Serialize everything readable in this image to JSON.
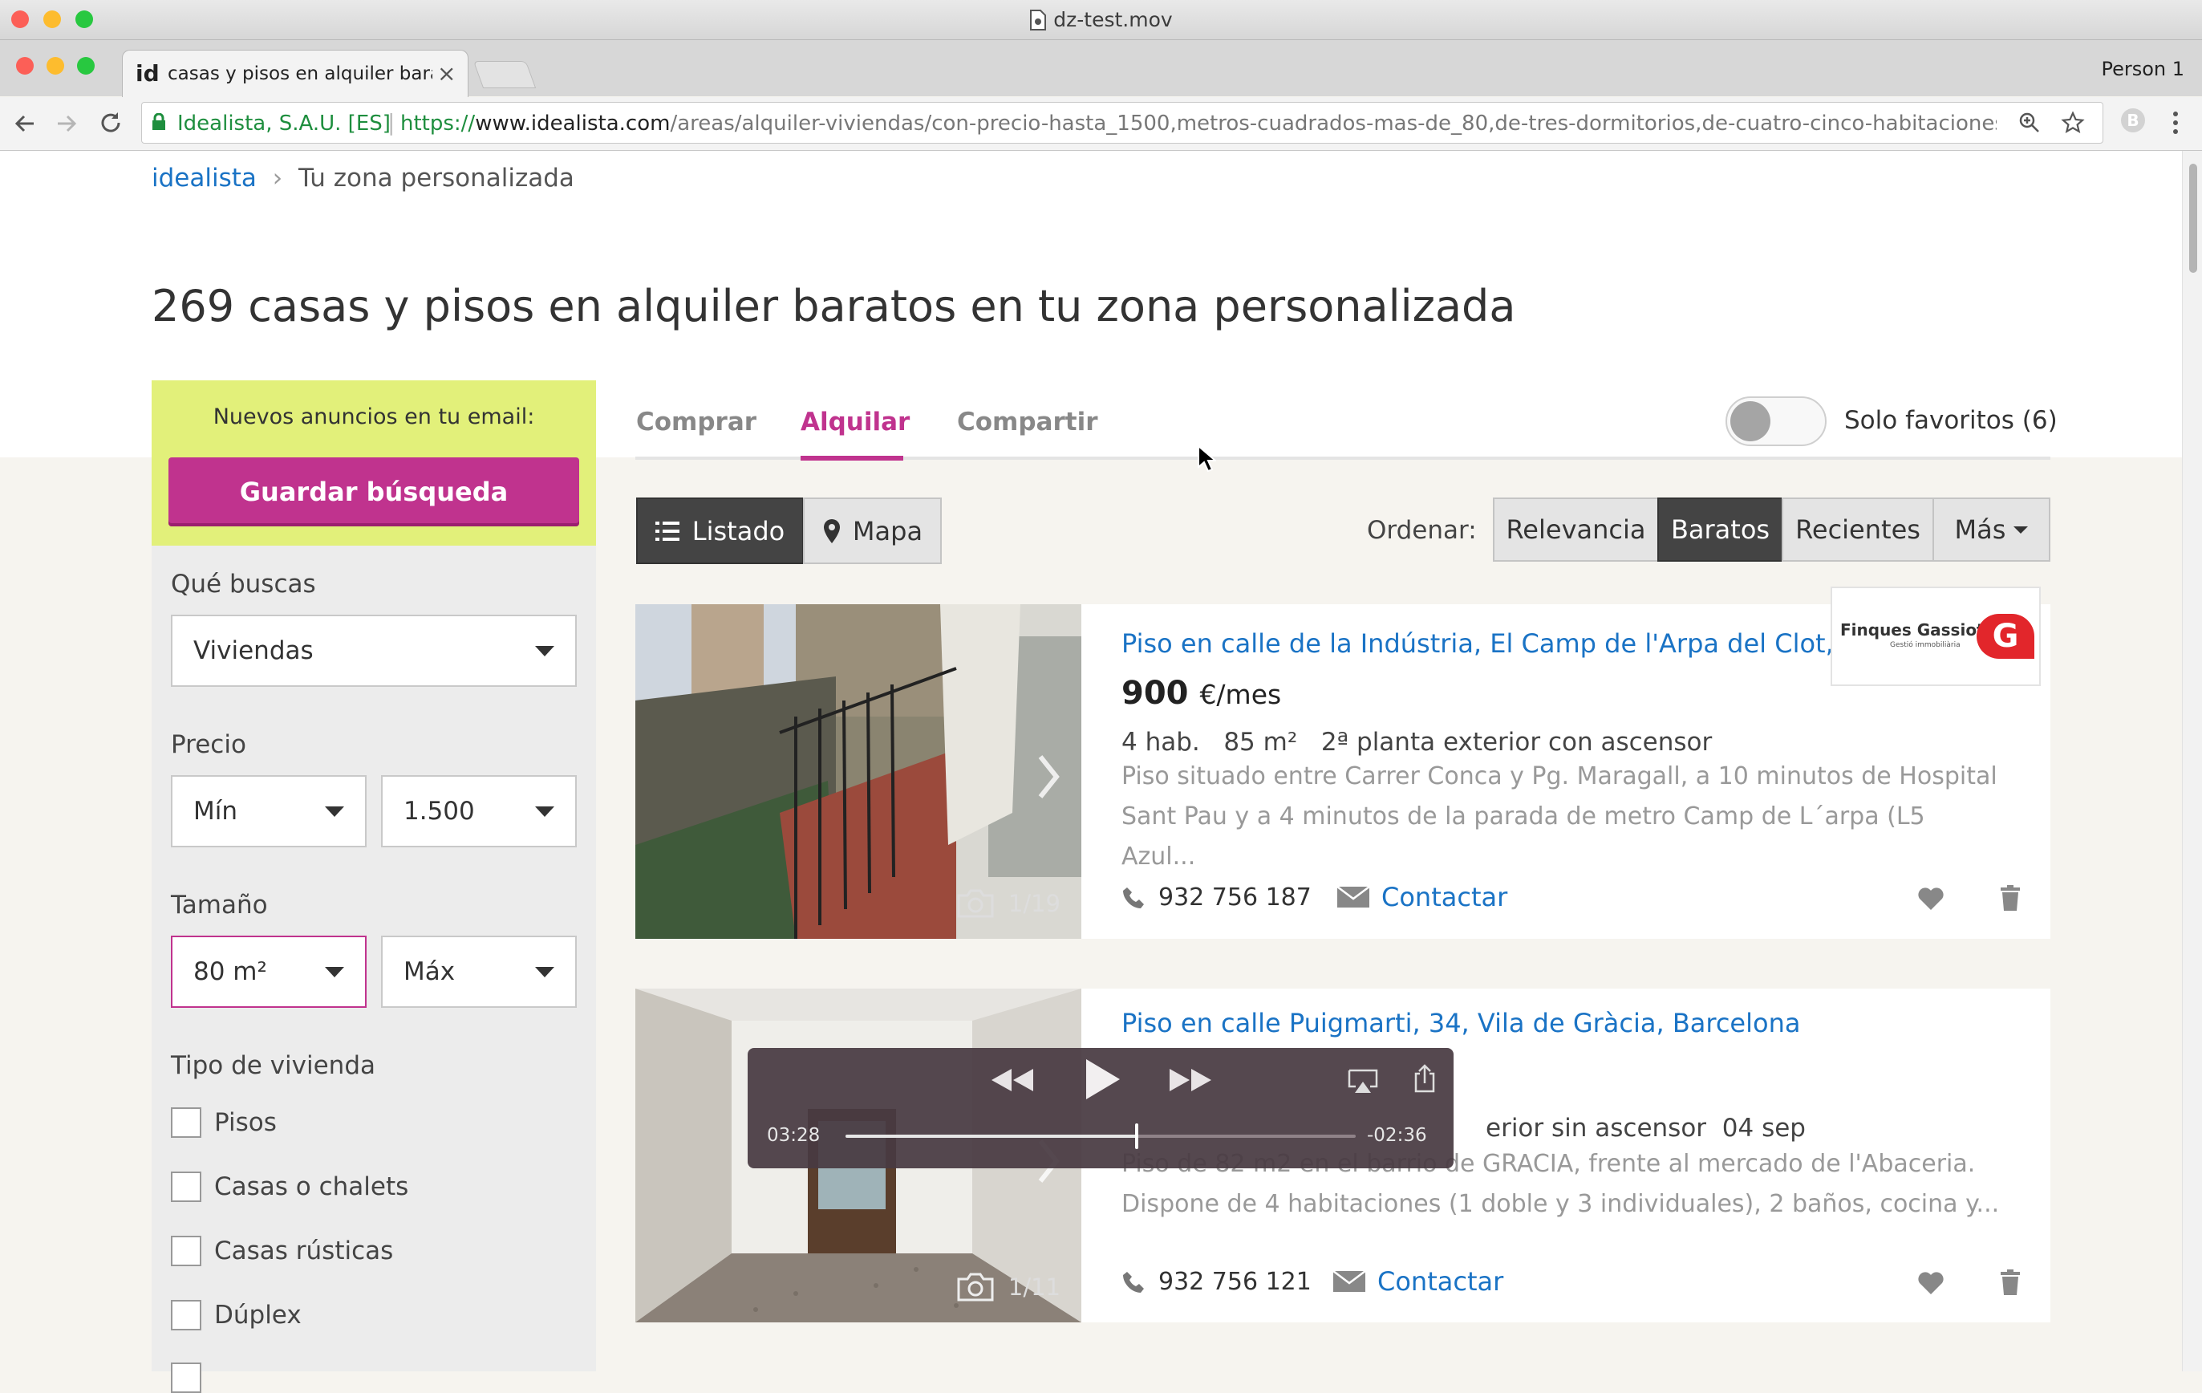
{
  "window": {
    "title": "dz-test.mov"
  },
  "browser": {
    "tab_title": "casas y pisos en alquiler barat",
    "profile": "Person 1",
    "security_label": "Idealista, S.A.U. [ES]",
    "url_scheme": "https://",
    "url_host": "www.idealista.com",
    "url_path": "/areas/alquiler-viviendas/con-precio-hasta_1500,metros-cuadrados-mas-de_80,de-tres-dormitorios,de-cuatro-cinco-habitaciones-o-m..."
  },
  "breadcrumb": {
    "home": "idealista",
    "current": "Tu zona personalizada"
  },
  "heading": "269 casas y pisos en alquiler baratos en tu zona personalizada",
  "save_search": {
    "prompt": "Nuevos anuncios en tu email:",
    "button": "Guardar búsqueda"
  },
  "filters": {
    "type_label": "Qué buscas",
    "type_value": "Viviendas",
    "price_label": "Precio",
    "price_min": "Mín",
    "price_max": "1.500",
    "size_label": "Tamaño",
    "size_min": "80 m²",
    "size_max": "Máx",
    "housing_label": "Tipo de vivienda",
    "housing_options": [
      "Pisos",
      "Casas o chalets",
      "Casas rústicas",
      "Dúplex"
    ]
  },
  "operation_tabs": [
    "Comprar",
    "Alquilar",
    "Compartir"
  ],
  "active_tab": "Alquilar",
  "favorites_toggle": {
    "label": "Solo favoritos (6)",
    "on": false
  },
  "view": {
    "list": "Listado",
    "map": "Mapa"
  },
  "sort": {
    "label": "Ordenar:",
    "options": [
      "Relevancia",
      "Baratos",
      "Recientes",
      "Más"
    ],
    "active": "Baratos"
  },
  "listings": [
    {
      "title": "Piso en calle de la Indústria, El Camp de l'Arpa del Clot, ...",
      "price": "900",
      "price_unit": "€/mes",
      "rooms": "4 hab.",
      "area": "85 m²",
      "floor": "2ª planta exterior con ascensor",
      "desc1": "Piso situado entre Carrer Conca y Pg. Maragall, a 10 minutos de Hospital",
      "desc2": "Sant Pau y a 4 minutos de la parada de metro Camp de L´arpa (L5 Azul...",
      "phone": "932 756 187",
      "contact": "Contactar",
      "photos": "1/19",
      "agency": "Finques Gassiot",
      "agency_sub": "Gestió immobiliària",
      "agency_mark": "G"
    },
    {
      "title": "Piso en calle Puigmarti, 34, Vila de Gràcia, Barcelona",
      "detail_visible": "erior sin ascensor",
      "date": "04 sep",
      "desc1": "Piso de 82 m2 en el barrio de GRACIA, frente al mercado de l'Abaceria.",
      "desc2": "Dispone de 4 habitaciones (1 doble y 3 individuales), 2 baños, cocina y...",
      "phone": "932 756 121",
      "contact": "Contactar",
      "photos": "1/11"
    }
  ],
  "player": {
    "elapsed": "03:28",
    "remaining": "-02:36",
    "progress": 0.57
  },
  "colors": {
    "brand": "#c0338e",
    "link": "#1a73c5",
    "highlight": "#e2f07a"
  }
}
